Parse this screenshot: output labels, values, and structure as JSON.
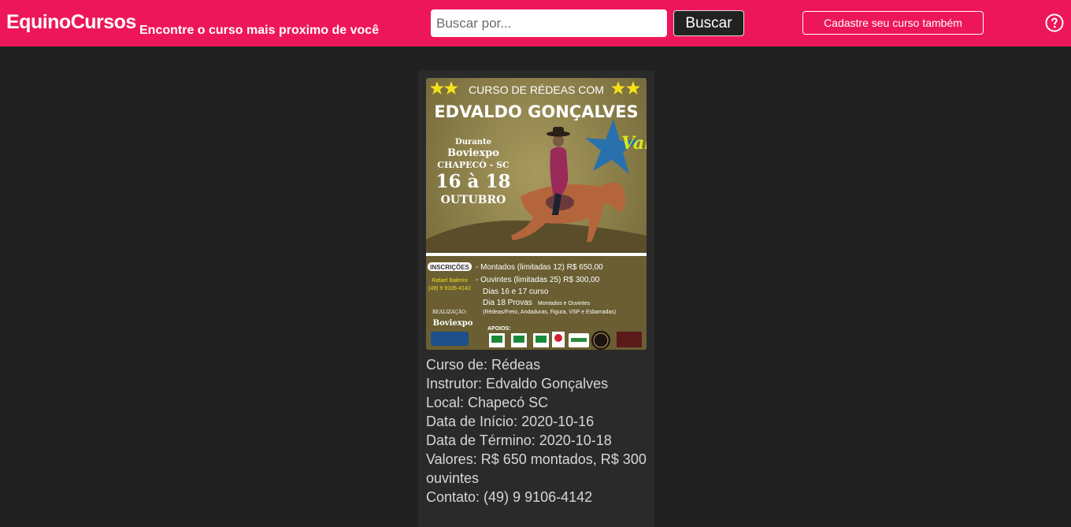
{
  "header": {
    "brand": "EquinoCursos",
    "tagline": "Encontre o curso mais proximo de você",
    "search_placeholder": "Buscar por...",
    "search_button": "Buscar",
    "register_button": "Cadastre seu curso também",
    "help_icon": "question-circle-icon"
  },
  "colors": {
    "header_bg": "#ee165a",
    "page_bg": "#212121",
    "card_bg": "#2a2a2a"
  },
  "poster": {
    "headline": "CURSO  DE RÉDEAS COM",
    "instructor": "EDVALDO GONÇALVES",
    "event_lines": [
      "Durante",
      "Boviexpo",
      "CHAPECÓ - SC",
      "16 à 18",
      "OUTUBRO"
    ],
    "inscricoes_label": "INSCRIÇÕES",
    "contact_name": "Rafael Balerini",
    "contact_phone": "(49) 9 9106-4142",
    "realizacao_label": "REALIZAÇÃO:",
    "realizacao_value": "Boviexpo",
    "price_lines": [
      "- Montados (limitadas 12) R$ 650,00",
      "- Ouvintes (limitadas 25) R$ 300,00",
      "Dias 16 e 17 curso",
      "Dia 18 Provas",
      "(Rédeas/Freio, Andaduras, Figura, VSP e Esbarradas)"
    ],
    "provas_note": "Montados e Ouvintes",
    "apoios_label": "APOIOS:"
  },
  "course": {
    "tipo": "Curso de: Rédeas",
    "instrutor": "Instrutor: Edvaldo Gonçalves",
    "local": "Local: Chapecó SC",
    "inicio": "Data de Início: 2020-10-16",
    "termino": "Data de Término: 2020-10-18",
    "valores": "Valores: R$ 650 montados, R$ 300 ouvintes",
    "contato": "Contato: (49) 9 9106-4142"
  }
}
